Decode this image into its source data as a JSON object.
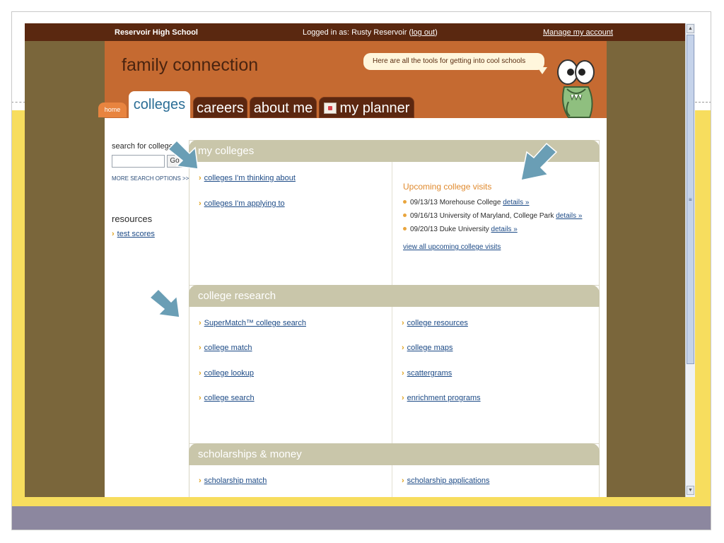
{
  "topbar": {
    "school": "Reservoir High School",
    "logged_in_prefix": "Logged in as: Rusty Reservoir (",
    "logout": "log out",
    "logged_in_suffix": ")",
    "manage_account": "Manage my account"
  },
  "header": {
    "brand": "family connection",
    "tagline": "Here are all the tools for getting into cool schools"
  },
  "tabs": {
    "home": "home",
    "colleges": "colleges",
    "careers": "careers",
    "about_me": "about me",
    "my_planner": "my planner"
  },
  "sidebar": {
    "search_label": "search for colleges:",
    "search_value": "",
    "go_label": "Go",
    "more_search": "MORE SEARCH OPTIONS >>",
    "resources_heading": "resources",
    "resources": [
      "test scores"
    ]
  },
  "my_colleges": {
    "title": "my colleges",
    "links": [
      "colleges I'm thinking about",
      "colleges I'm applying to"
    ],
    "visits_heading": "Upcoming college visits",
    "visits": [
      {
        "text": "09/13/13 Morehouse College",
        "link": "details »"
      },
      {
        "text": "09/16/13 University of Maryland, College Park",
        "link": "details »"
      },
      {
        "text": "09/20/13 Duke University",
        "link": "details »"
      }
    ],
    "view_all": "view all upcoming college visits"
  },
  "college_research": {
    "title": "college research",
    "left_links": [
      "SuperMatch™ college search",
      "college match",
      "college lookup",
      "college search"
    ],
    "right_links": [
      "college resources",
      "college maps",
      "scattergrams",
      "enrichment programs"
    ]
  },
  "scholarships": {
    "title": "scholarships & money",
    "left_links": [
      "scholarship match"
    ],
    "right_links": [
      "scholarship applications"
    ]
  },
  "colors": {
    "topbar": "#5a2810",
    "header": "#c56a31",
    "panel_header": "#c9c6aa",
    "link": "#1c4a86",
    "arrow": "#6a9eb5",
    "slide_yellow": "#f7dd5e",
    "slide_footer": "#8c879f"
  }
}
